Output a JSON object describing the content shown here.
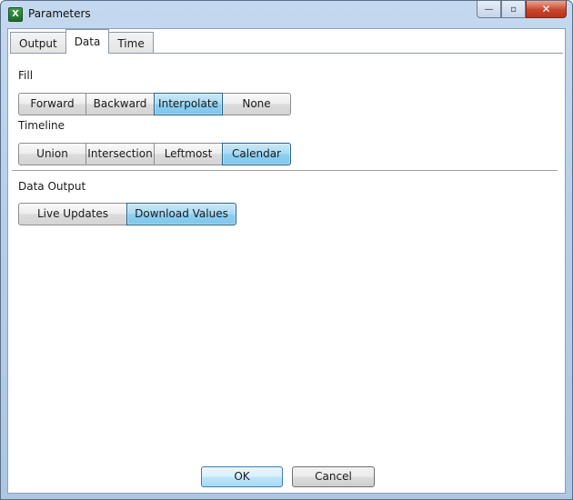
{
  "window": {
    "title": "Parameters",
    "icon": "excel-icon",
    "icon_glyph": "X"
  },
  "caption_buttons": {
    "minimize": "—",
    "maximize": "▫",
    "close": "✕"
  },
  "tabs": [
    {
      "label": "Output",
      "active": false
    },
    {
      "label": "Data",
      "active": true
    },
    {
      "label": "Time",
      "active": false
    }
  ],
  "fill": {
    "label": "Fill",
    "options": [
      "Forward",
      "Backward",
      "Interpolate",
      "None"
    ],
    "selected": "Interpolate"
  },
  "timeline": {
    "label": "Timeline",
    "options": [
      "Union",
      "Intersection",
      "Leftmost",
      "Calendar"
    ],
    "selected": "Calendar"
  },
  "data_output": {
    "label": "Data Output",
    "options": [
      "Live Updates",
      "Download Values"
    ],
    "selected": "Download Values"
  },
  "footer": {
    "ok_label": "OK",
    "cancel_label": "Cancel"
  },
  "colors": {
    "selected_segment": "#8ecff0",
    "window_frame": "#b8cfe8",
    "close_button": "#c9462c"
  }
}
